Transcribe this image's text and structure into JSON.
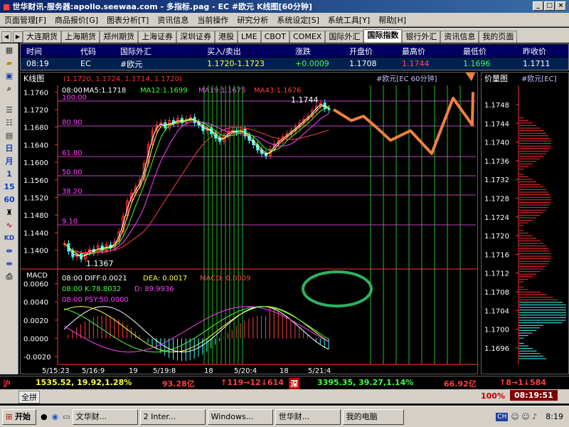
{
  "window": {
    "title": "世华财讯-服务器:apollo.seewaa.com  - 多指标.pag - EC #欧元  K线图[60分钟]"
  },
  "menu": [
    "页面管理[F]",
    "商品报价[G]",
    "图表分析[T]",
    "资讯信息",
    "当前操作",
    "研究分析",
    "系统设定[S]",
    "系统工具[Y]",
    "帮助[H]"
  ],
  "tabs": [
    "大连期货",
    "上海期货",
    "郑州期货",
    "上海证券",
    "深圳证券",
    "港股",
    "LME",
    "CBOT",
    "COMEX",
    "国际外汇",
    "国际指数",
    "银行外汇",
    "资讯信息",
    "我的页面"
  ],
  "active_tab": "国际指数",
  "left_toolbar": [
    "日",
    "月",
    "1",
    "15",
    "60"
  ],
  "quote": {
    "headers": [
      "时间",
      "代码",
      "国际外汇",
      "买入/卖出",
      "涨跌",
      "开盘价",
      "最高价",
      "最低价",
      "昨收价"
    ],
    "values": [
      "08:19",
      "EC",
      "#欧元",
      "1.1720-1.1723",
      "+0.0009",
      "1.1708",
      "1.1744",
      "1.1696",
      "1.1711"
    ]
  },
  "kline": {
    "label": "K线图",
    "ohlc": "(1.1720, 1.1724, 1.1714, 1.1720)",
    "title": "#欧元[EC 60分钟]",
    "ma_time": "08:00",
    "ma5": "MA5:1.1718",
    "ma12": "MA12:1.1699",
    "ma19": "MA19:1.1675",
    "ma43": "MA43:1.1676",
    "high_label": "1.1744",
    "low_label": "1.1367",
    "fib_labels": [
      "100.00",
      "80.90",
      "61.80",
      "50.00",
      "38.20",
      "9.10"
    ]
  },
  "macd": {
    "label": "MACD",
    "diff": "08:00 DIFF:0.0021",
    "dea": "DEA: 0.0017",
    "macd": "MACD: 0.0009",
    "kdj": "08:00 K:78.8032",
    "d": "D: 89.9936",
    "psy": "08:00 PSY:50.0000"
  },
  "volume": {
    "title": "价量图",
    "code": "#欧元[EC]",
    "price_ticks": [
      "1.1748",
      "1.1744",
      "1.1740",
      "1.1736",
      "1.1732",
      "1.1728",
      "1.1724",
      "1.1720",
      "1.1716",
      "1.1712",
      "1.1708",
      "1.1704",
      "1.1700",
      "1.1696"
    ]
  },
  "chart_data": {
    "type": "line",
    "title": "#欧元[EC 60分钟]",
    "ylim": [
      1.1367,
      1.1775
    ],
    "y_ticks": [
      1.176,
      1.172,
      1.168,
      1.164,
      1.16,
      1.156,
      1.152,
      1.148,
      1.144,
      1.14
    ],
    "x_ticks": [
      "5/15:23",
      "5/16:9",
      "19",
      "5/19:8",
      "18",
      "5/20:4",
      "18",
      "5/21:4"
    ],
    "macd_y_ticks": [
      0.006,
      0.004,
      0.002,
      0.0,
      -0.002
    ],
    "close": [
      1.1415,
      1.1398,
      1.1385,
      1.1392,
      1.138,
      1.1395,
      1.1402,
      1.1395,
      1.141,
      1.14,
      1.1412,
      1.1405,
      1.142,
      1.1442,
      1.1478,
      1.1512,
      1.153,
      1.1545,
      1.156,
      1.1598,
      1.164,
      1.1672,
      1.1685,
      1.169,
      1.1678,
      1.1695,
      1.1688,
      1.17,
      1.169,
      1.1698,
      1.1702,
      1.169,
      1.1685,
      1.1672,
      1.1678,
      1.1665,
      1.1655,
      1.1648,
      1.166,
      1.167,
      1.1672,
      1.1668,
      1.1675,
      1.166,
      1.165,
      1.164,
      1.1628,
      1.162,
      1.1615,
      1.163,
      1.1642,
      1.165,
      1.1658,
      1.1665,
      1.1672,
      1.168,
      1.169,
      1.1698,
      1.1705,
      1.1718,
      1.1728,
      1.1735,
      1.1722,
      1.172
    ],
    "projection": [
      1.172,
      1.1695,
      1.1705,
      1.168,
      1.165,
      1.1672,
      1.162,
      1.1746,
      1.1685,
      1.176
    ]
  },
  "status": {
    "idx1": "1535.52, 19.92,1.28%",
    "amt1": "93.28亿",
    "breadth1": "↑119→12↓614",
    "shen": "深",
    "idx2": "3395.35, 39.27,1.14%",
    "amt2": "66.92亿",
    "breadth2": "↑8→1↓584",
    "hu": "沪"
  },
  "status2": {
    "btn": "全拼",
    "zoom": "100%",
    "clock": "08:19:51"
  },
  "taskbar": {
    "start": "开始",
    "items": [
      "文华财...",
      "2 Inter...",
      "Windows...",
      "世华财...",
      "我的电脑"
    ],
    "time": "8:19"
  }
}
